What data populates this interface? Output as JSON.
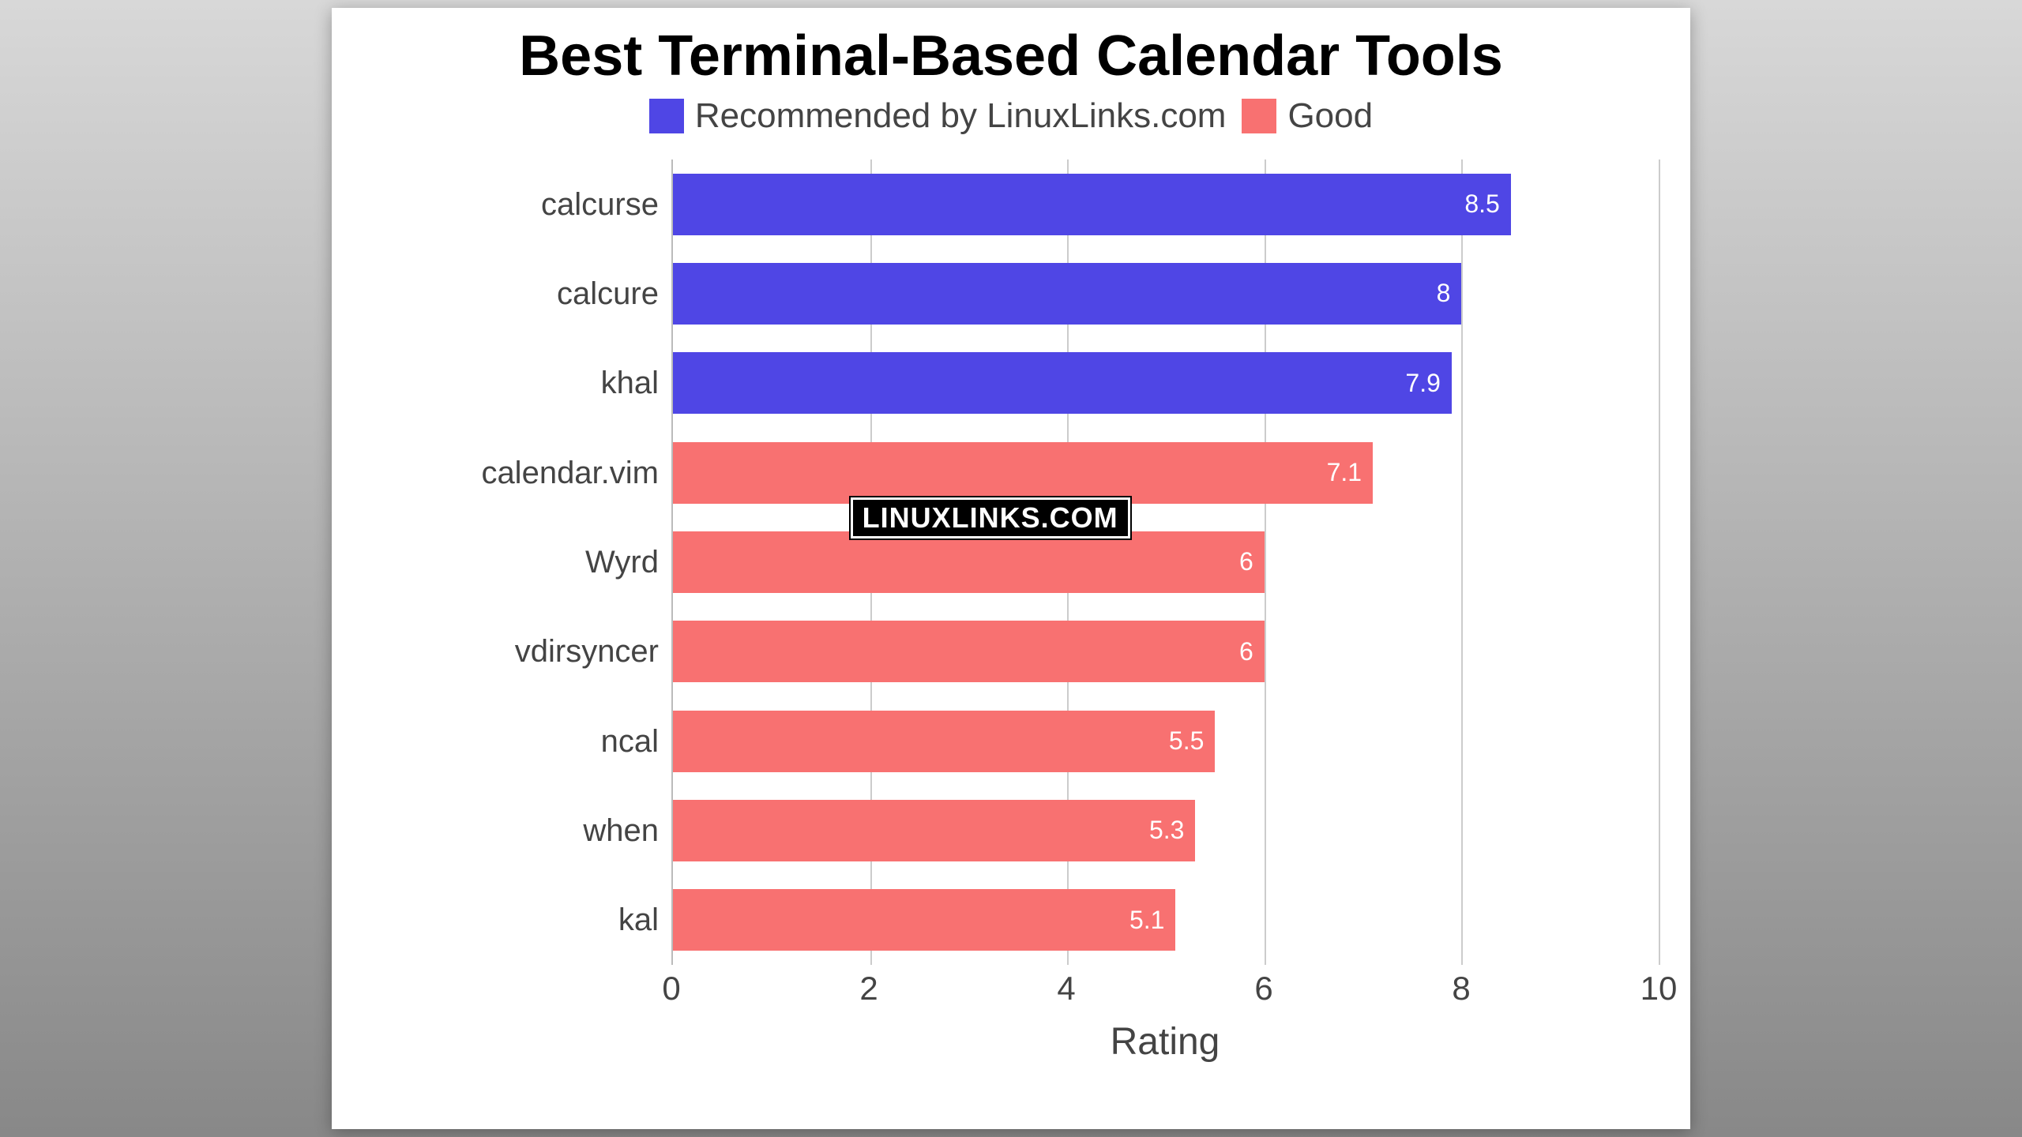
{
  "chart_data": {
    "type": "bar",
    "orientation": "horizontal",
    "title": "Best Terminal-Based Calendar Tools",
    "xlabel": "Rating",
    "ylabel": "",
    "xlim": [
      0,
      10
    ],
    "x_ticks": [
      0,
      2,
      4,
      6,
      8,
      10
    ],
    "categories": [
      "calcurse",
      "calcure",
      "khal",
      "calendar.vim",
      "Wyrd",
      "vdirsyncer",
      "ncal",
      "when",
      "kal"
    ],
    "values": [
      8.5,
      8,
      7.9,
      7.1,
      6,
      6,
      5.5,
      5.3,
      5.1
    ],
    "series_assignment": [
      "Recommended by LinuxLinks.com",
      "Recommended by LinuxLinks.com",
      "Recommended by LinuxLinks.com",
      "Good",
      "Good",
      "Good",
      "Good",
      "Good",
      "Good"
    ],
    "legend": [
      {
        "name": "Recommended by LinuxLinks.com",
        "color": "#4f46e5"
      },
      {
        "name": "Good",
        "color": "#f87171"
      }
    ],
    "watermark": "LINUXLINKS.COM"
  }
}
